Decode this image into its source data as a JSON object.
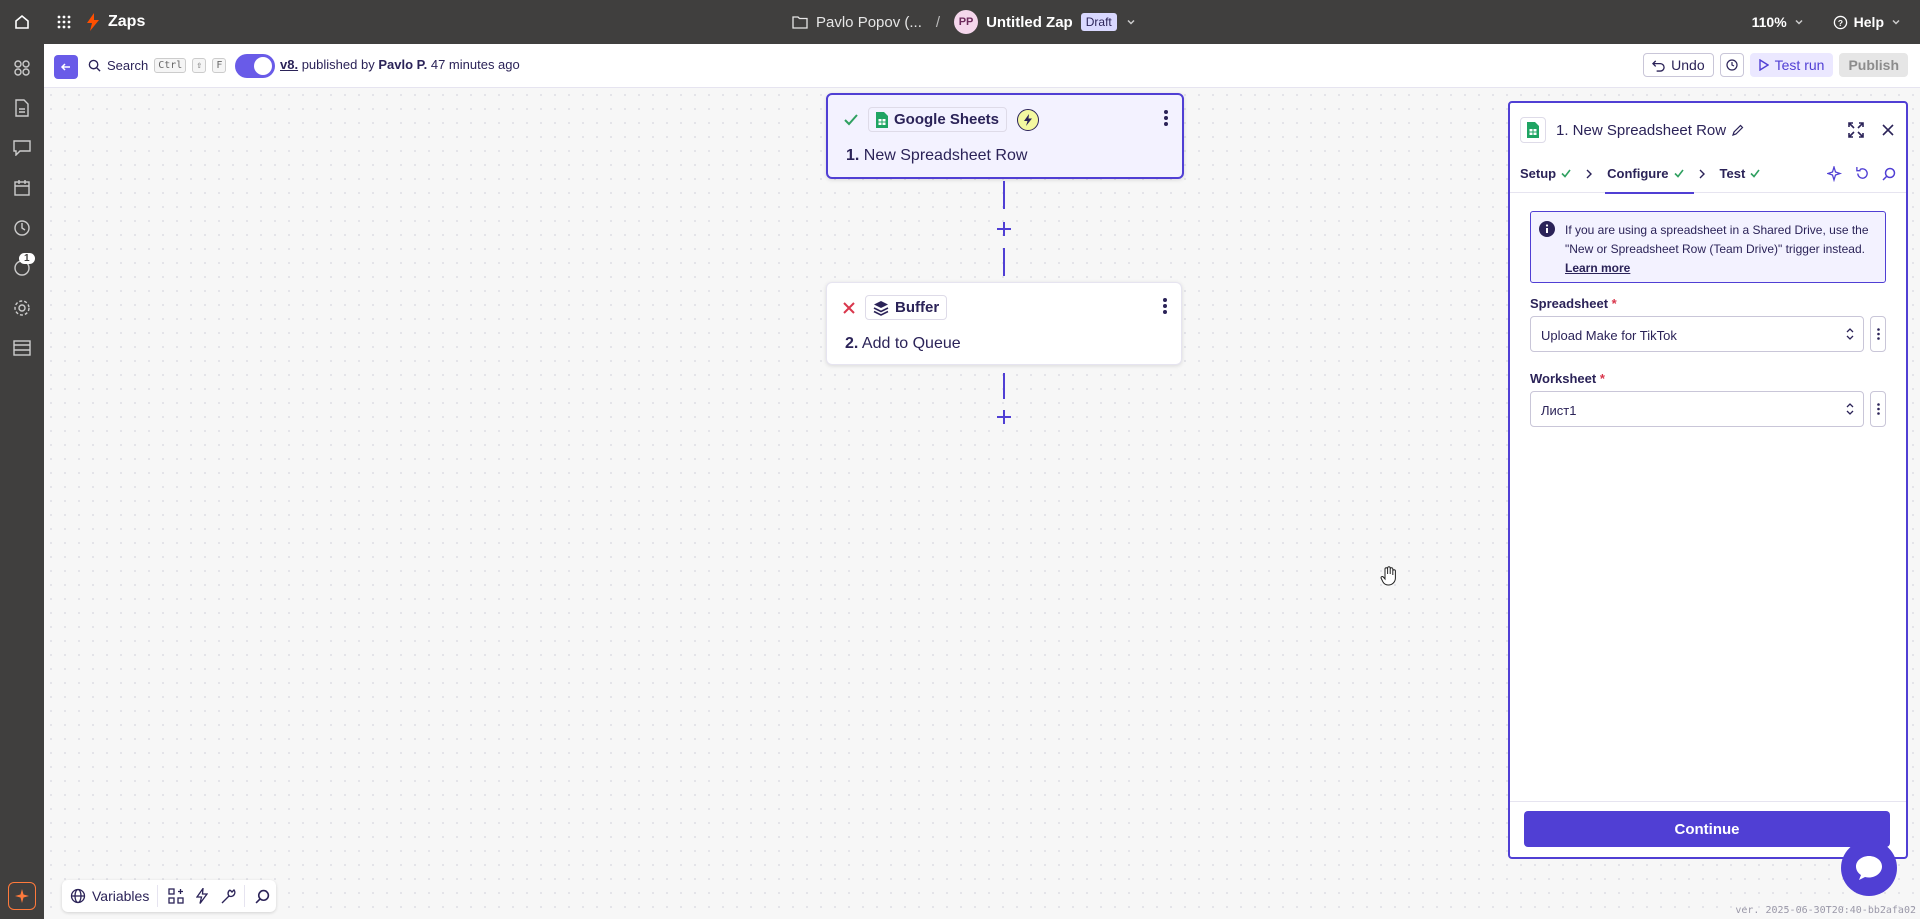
{
  "topbar": {
    "app_name": "Zaps",
    "folder": "Pavlo Popov (...",
    "separator": "/",
    "avatar_initials": "PP",
    "zap_title": "Untitled Zap",
    "status": "Draft",
    "zoom": "110%",
    "help": "Help"
  },
  "rail": {
    "notification_count": "1"
  },
  "subbar": {
    "search_label": "Search",
    "kbd_ctrl": "Ctrl",
    "kbd_shift": "⇧",
    "kbd_f": "F",
    "version_link": "v8.",
    "published_by": "published by",
    "author": "Pavlo P.",
    "time_ago": "47 minutes ago",
    "undo_label": "Undo",
    "test_run_label": "Test run",
    "publish_label": "Publish"
  },
  "steps": [
    {
      "app": "Google Sheets",
      "number": "1.",
      "title": "New Spreadsheet Row",
      "status": "ok"
    },
    {
      "app": "Buffer",
      "number": "2.",
      "title": "Add to Queue",
      "status": "error"
    }
  ],
  "panel": {
    "title": "1. New Spreadsheet Row",
    "tabs": [
      {
        "label": "Setup"
      },
      {
        "label": "Configure"
      },
      {
        "label": "Test"
      }
    ],
    "info_text": "If you are using a spreadsheet in a Shared Drive, use the \"New or Spreadsheet Row (Team Drive)\" trigger instead.",
    "info_link": "Learn more",
    "spreadsheet_label": "Spreadsheet",
    "spreadsheet_value": "Upload Make for TikTok",
    "worksheet_label": "Worksheet",
    "worksheet_value": "Лист1",
    "required_mark": "*",
    "continue_label": "Continue"
  },
  "bottombar": {
    "variables_label": "Variables"
  },
  "footer": {
    "version_string": "ver. 2025-06-30T20:40-bb2afa02"
  },
  "colors": {
    "accent": "#503fd4",
    "topbar": "#403f3e",
    "brand": "#ff4f00",
    "success": "#2fa060",
    "error": "#d9364c"
  }
}
